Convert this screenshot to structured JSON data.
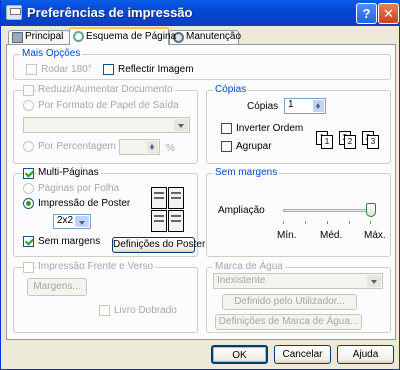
{
  "window": {
    "title": "Preferências de impressão",
    "help_btn": "?",
    "close_btn": "✕"
  },
  "tabs": [
    {
      "label": "Principal",
      "icon": "printer-icon"
    },
    {
      "label": "Esquema de Página",
      "icon": "layout-icon"
    },
    {
      "label": "Manutenção",
      "icon": "maintenance-icon"
    }
  ],
  "mais_opcoes": {
    "title": "Mais Opções",
    "rodar": "Rodar 180°",
    "reflectir": "Reflectir Imagem"
  },
  "reduzir": {
    "checkbox": "Reduzir/Aumentar Documento",
    "por_formato": "Por Formato de Papel de Saída",
    "por_percentagem": "Por Percentagem",
    "percent_sign": "%"
  },
  "multi": {
    "checkbox": "Multi-Páginas",
    "paginas_por_folha": "Páginas por Folha",
    "impressao_poster": "Impressão de Poster",
    "poster_size": "2x2",
    "sem_margens": "Sem margens",
    "definicoes_button": "Definições do Poster"
  },
  "frente_verso": {
    "checkbox": "Impressão Frente e Verso",
    "margens_button": "Margens...",
    "livro": "Livro Dobrado"
  },
  "copias": {
    "title": "Cópias",
    "label": "Cópias",
    "value": "1",
    "inverter": "Inverter Ordem",
    "agrupar": "Agrupar"
  },
  "sem_margens": {
    "title": "Sem margens",
    "ampliacao": "Ampliação",
    "min": "Mín.",
    "med": "Méd.",
    "max": "Máx.",
    "slider_position": "max"
  },
  "marca_agua": {
    "title": "Marca de Água",
    "select_value": "Inexistente",
    "definido_button": "Definido pelo Utilizador...",
    "definicoes_button": "Definições de Marca de Água..."
  },
  "footer": {
    "ok": "OK",
    "cancelar": "Cancelar",
    "ajuda": "Ajuda"
  },
  "colors": {
    "title_bar": "#0548d4",
    "group_label": "#0046d5",
    "check": "#21a121",
    "window_bg": "#ece9d8"
  }
}
